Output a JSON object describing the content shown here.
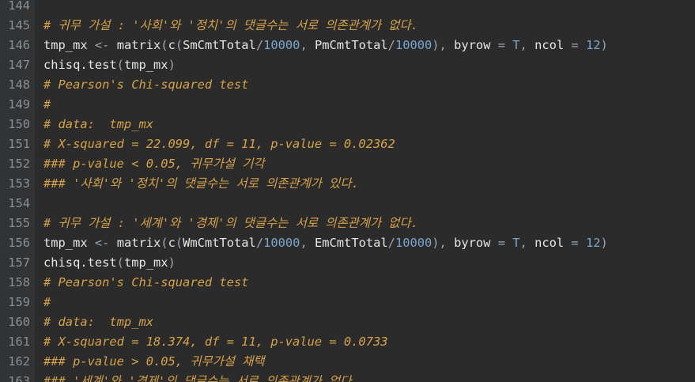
{
  "editor": {
    "colors": {
      "background": "#2b2b2b",
      "gutter": "#313335",
      "line_number": "#8a8f93",
      "comment": "#d6a24a",
      "text": "#e6e6e6",
      "operator": "#9aa6b4",
      "number": "#7aa6cf"
    },
    "lines": [
      {
        "n": "144",
        "tokens": []
      },
      {
        "n": "145",
        "tokens": [
          {
            "t": "cm",
            "v": "# 귀무 가설 : '사회'와 '정치'의 댓글수는 서로 의존관계가 없다."
          }
        ]
      },
      {
        "n": "146",
        "tokens": [
          {
            "t": "tx",
            "v": "tmp_mx "
          },
          {
            "t": "op",
            "v": "<-"
          },
          {
            "t": "tx",
            "v": " matrix"
          },
          {
            "t": "op",
            "v": "("
          },
          {
            "t": "tx",
            "v": "c"
          },
          {
            "t": "op",
            "v": "("
          },
          {
            "t": "tx",
            "v": "SmCmtTotal"
          },
          {
            "t": "op",
            "v": "/"
          },
          {
            "t": "num",
            "v": "10000"
          },
          {
            "t": "op",
            "v": ", "
          },
          {
            "t": "tx",
            "v": "PmCmtTotal"
          },
          {
            "t": "op",
            "v": "/"
          },
          {
            "t": "num",
            "v": "10000"
          },
          {
            "t": "op",
            "v": "), "
          },
          {
            "t": "tx",
            "v": "byrow "
          },
          {
            "t": "op",
            "v": "= "
          },
          {
            "t": "kw",
            "v": "T"
          },
          {
            "t": "op",
            "v": ", "
          },
          {
            "t": "tx",
            "v": "ncol "
          },
          {
            "t": "op",
            "v": "= "
          },
          {
            "t": "num",
            "v": "12"
          },
          {
            "t": "op",
            "v": ")"
          }
        ]
      },
      {
        "n": "147",
        "tokens": [
          {
            "t": "tx",
            "v": "chisq.test"
          },
          {
            "t": "op",
            "v": "("
          },
          {
            "t": "tx",
            "v": "tmp_mx"
          },
          {
            "t": "op",
            "v": ")"
          }
        ]
      },
      {
        "n": "148",
        "tokens": [
          {
            "t": "cm",
            "v": "# Pearson's Chi-squared test"
          }
        ]
      },
      {
        "n": "149",
        "tokens": [
          {
            "t": "cm",
            "v": "#"
          }
        ]
      },
      {
        "n": "150",
        "tokens": [
          {
            "t": "cm",
            "v": "# data:  tmp_mx"
          }
        ]
      },
      {
        "n": "151",
        "tokens": [
          {
            "t": "cm",
            "v": "# X-squared = 22.099, df = 11, p-value = 0.02362"
          }
        ]
      },
      {
        "n": "152",
        "tokens": [
          {
            "t": "cm",
            "v": "### p-value < 0.05, 귀무가설 기각"
          }
        ]
      },
      {
        "n": "153",
        "tokens": [
          {
            "t": "cm",
            "v": "### '사회'와 '정치'의 댓글수는 서로 의존관계가 있다."
          }
        ]
      },
      {
        "n": "154",
        "tokens": []
      },
      {
        "n": "155",
        "tokens": [
          {
            "t": "cm",
            "v": "# 귀무 가설 : '세계'와 '경제'의 댓글수는 서로 의존관계가 없다."
          }
        ]
      },
      {
        "n": "156",
        "tokens": [
          {
            "t": "tx",
            "v": "tmp_mx "
          },
          {
            "t": "op",
            "v": "<-"
          },
          {
            "t": "tx",
            "v": " matrix"
          },
          {
            "t": "op",
            "v": "("
          },
          {
            "t": "tx",
            "v": "c"
          },
          {
            "t": "op",
            "v": "("
          },
          {
            "t": "tx",
            "v": "WmCmtTotal"
          },
          {
            "t": "op",
            "v": "/"
          },
          {
            "t": "num",
            "v": "10000"
          },
          {
            "t": "op",
            "v": ", "
          },
          {
            "t": "tx",
            "v": "EmCmtTotal"
          },
          {
            "t": "op",
            "v": "/"
          },
          {
            "t": "num",
            "v": "10000"
          },
          {
            "t": "op",
            "v": "), "
          },
          {
            "t": "tx",
            "v": "byrow "
          },
          {
            "t": "op",
            "v": "= "
          },
          {
            "t": "kw",
            "v": "T"
          },
          {
            "t": "op",
            "v": ", "
          },
          {
            "t": "tx",
            "v": "ncol "
          },
          {
            "t": "op",
            "v": "= "
          },
          {
            "t": "num",
            "v": "12"
          },
          {
            "t": "op",
            "v": ")"
          }
        ]
      },
      {
        "n": "157",
        "tokens": [
          {
            "t": "tx",
            "v": "chisq.test"
          },
          {
            "t": "op",
            "v": "("
          },
          {
            "t": "tx",
            "v": "tmp_mx"
          },
          {
            "t": "op",
            "v": ")"
          }
        ]
      },
      {
        "n": "158",
        "tokens": [
          {
            "t": "cm",
            "v": "# Pearson's Chi-squared test"
          }
        ]
      },
      {
        "n": "159",
        "tokens": [
          {
            "t": "cm",
            "v": "#"
          }
        ]
      },
      {
        "n": "160",
        "tokens": [
          {
            "t": "cm",
            "v": "# data:  tmp_mx"
          }
        ]
      },
      {
        "n": "161",
        "tokens": [
          {
            "t": "cm",
            "v": "# X-squared = 18.374, df = 11, p-value = 0.0733"
          }
        ]
      },
      {
        "n": "162",
        "tokens": [
          {
            "t": "cm",
            "v": "### p-value > 0.05, 귀무가설 채택"
          }
        ]
      },
      {
        "n": "163",
        "tokens": [
          {
            "t": "cm",
            "v": "### '세계'와 '경제'의 댓글수는 서로 의존관계가 없다."
          }
        ]
      }
    ]
  }
}
